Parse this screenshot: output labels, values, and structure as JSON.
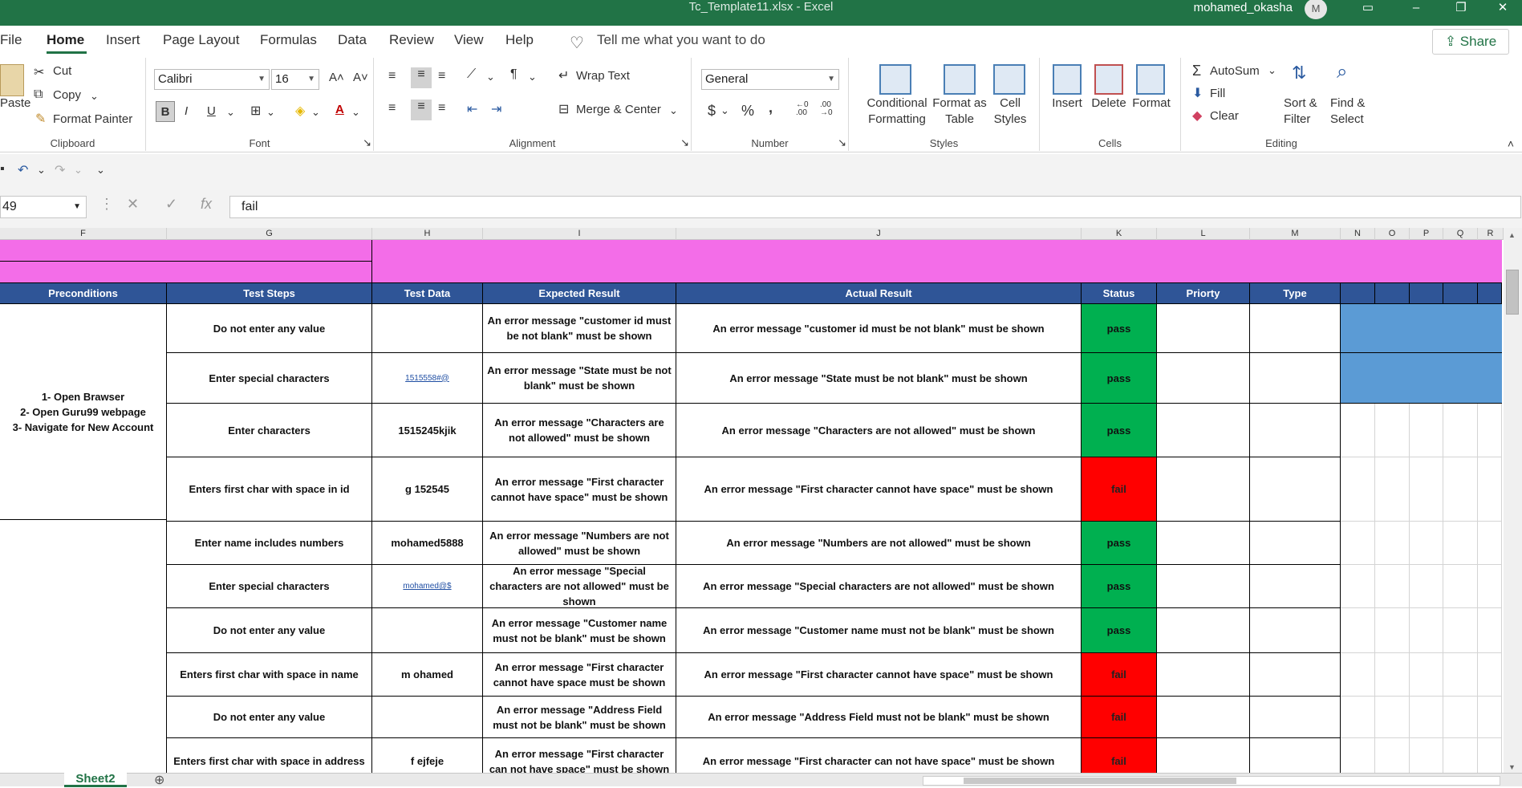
{
  "window": {
    "title": "Tc_Template11.xlsx  -  Excel",
    "user": "mohamed_okasha",
    "avatar_letter": "M"
  },
  "ribbon_tabs": [
    "File",
    "Home",
    "Insert",
    "Page Layout",
    "Formulas",
    "Data",
    "Review",
    "View",
    "Help"
  ],
  "tell_me": "Tell me what you want to do",
  "share_label": "Share",
  "clipboard": {
    "paste": "Paste",
    "cut": "Cut",
    "copy": "Copy",
    "format_painter": "Format Painter",
    "label": "Clipboard"
  },
  "font": {
    "name": "Calibri",
    "size": "16",
    "label": "Font",
    "bold": "B",
    "italic": "I",
    "underline": "U",
    "grow": "A˄",
    "shrink": "A˅",
    "font_color": "A"
  },
  "alignment": {
    "wrap": "Wrap Text",
    "merge": "Merge & Center",
    "label": "Alignment"
  },
  "number": {
    "format": "General",
    "label": "Number",
    "currency": "$",
    "percent": "%",
    "comma": ","
  },
  "styles": {
    "conditional_line1": "Conditional",
    "conditional_line2": "Formatting",
    "table_line1": "Format as",
    "table_line2": "Table",
    "cell_line1": "Cell",
    "cell_line2": "Styles",
    "label": "Styles"
  },
  "cells": {
    "insert": "Insert",
    "delete": "Delete",
    "format": "Format",
    "label": "Cells"
  },
  "editing": {
    "autosum": "AutoSum",
    "fill": "Fill",
    "clear": "Clear",
    "sort_line1": "Sort &",
    "sort_line2": "Filter",
    "find_line1": "Find &",
    "find_line2": "Select",
    "label": "Editing"
  },
  "formula_bar": {
    "name_box": "49",
    "value": "fail",
    "fx": "fx"
  },
  "columns": [
    "F",
    "G",
    "H",
    "I",
    "J",
    "K",
    "L",
    "M",
    "N",
    "O",
    "P",
    "Q",
    "R"
  ],
  "header": [
    "Preconditions",
    "Test Steps",
    "Test Data",
    "Expected Result",
    "Actual Result",
    "Status",
    "Priorty",
    "Type"
  ],
  "preconditions": [
    "1- Open Brawser",
    "2- Open Guru99 webpage",
    "3- Navigate for New Account"
  ],
  "rows": [
    {
      "step": "Do not enter any value",
      "data": "",
      "expected": "An error message \"customer id must be not blank\" must be shown",
      "actual": "An error message \"customer id must be not blank\" must be shown",
      "status": "pass"
    },
    {
      "step": "Enter special characters",
      "data": "1515558#@",
      "expected": "An error message \"State must be not blank\" must be shown",
      "actual": "An error message \"State must be not blank\" must be shown",
      "status": "pass"
    },
    {
      "step": "Enter  characters",
      "data": "1515245kjik",
      "expected": "An error message \"Characters are not allowed\" must be shown",
      "actual": "An error message \"Characters are not allowed\" must be shown",
      "status": "pass"
    },
    {
      "step": "Enters first char with space in id",
      "data": "g 152545",
      "expected": "An error message \"First character cannot have space\" must be shown",
      "actual": "An error message \"First character cannot have space\" must be shown",
      "status": "fail"
    },
    {
      "step": "Enter name includes numbers",
      "data": "mohamed5888",
      "expected": "An error message \"Numbers are not allowed\" must be shown",
      "actual": "An error message \"Numbers are not allowed\" must be shown",
      "status": "pass"
    },
    {
      "step": "Enter special characters",
      "data": "mohamed@$",
      "expected": "An error message \"Special characters are not allowed\" must be shown",
      "actual": "An error message \"Special characters are not allowed\" must be shown",
      "status": "pass"
    },
    {
      "step": "Do not enter any value",
      "data": "",
      "expected": "An error message \"Customer name must not be blank\" must be shown",
      "actual": "An error message \"Customer name must not be blank\" must be shown",
      "status": "pass"
    },
    {
      "step": "Enters first char with space in name",
      "data": "m ohamed",
      "expected": "An error message \"First character cannot have space must be shown",
      "actual": "An error message \"First character cannot have space\" must be shown",
      "status": "fail"
    },
    {
      "step": "Do not enter any value",
      "data": "",
      "expected": "An error message \"Address Field must not be blank\" must be shown",
      "actual": "An error message \"Address Field must not be blank\" must be shown",
      "status": "fail"
    },
    {
      "step": "Enters first char with space in address",
      "data": "f ejfeje",
      "expected": "An error message \"First character can not have space\" must be shown",
      "actual": "An error message \"First character can not have space\" must be shown",
      "status": "fail"
    }
  ],
  "sheet_tab": "Sheet2",
  "colors": {
    "excel_green": "#217346",
    "header_blue": "#2f5597",
    "pink": "#f36de8",
    "pass_green": "#00b050",
    "fail_red": "#ff0000",
    "side_blue": "#5b9bd5"
  }
}
